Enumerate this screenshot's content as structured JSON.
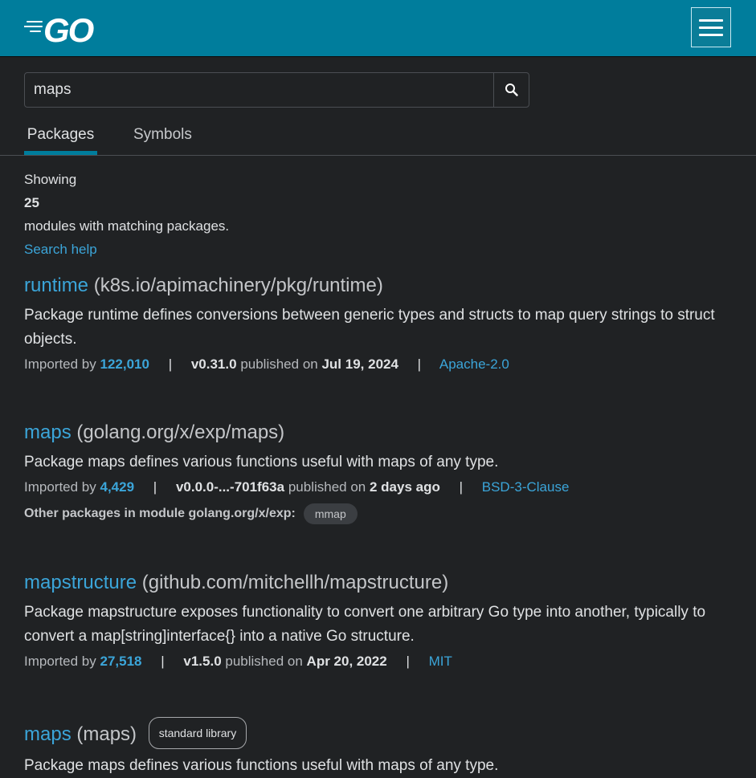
{
  "header": {
    "logo_text": "GO",
    "menu_icon": "hamburger-menu-icon"
  },
  "search": {
    "value": "maps",
    "icon": "search-icon"
  },
  "tabs": [
    {
      "label": "Packages",
      "active": true
    },
    {
      "label": "Symbols",
      "active": false
    }
  ],
  "summary": {
    "showing": "Showing",
    "count": "25",
    "text": "modules with matching packages.",
    "help_link": "Search help"
  },
  "results": [
    {
      "name": "runtime",
      "path": "(k8s.io/apimachinery/pkg/runtime)",
      "description": "Package runtime defines conversions between generic types and structs to map query strings to struct objects.",
      "imported_label": "Imported by",
      "imported_count": "122,010",
      "version": "v0.31.0",
      "published_label": "published on",
      "published": "Jul 19, 2024",
      "license": "Apache-2.0"
    },
    {
      "name": "maps",
      "path": "(golang.org/x/exp/maps)",
      "description": "Package maps defines various functions useful with maps of any type.",
      "imported_label": "Imported by",
      "imported_count": "4,429",
      "version": "v0.0.0-...-701f63a",
      "published_label": "published on",
      "published": "2 days ago",
      "license": "BSD-3-Clause",
      "other_label": "Other packages in module golang.org/x/exp:",
      "other_packages": [
        "mmap"
      ]
    },
    {
      "name": "mapstructure",
      "path": "(github.com/mitchellh/mapstructure)",
      "description": "Package mapstructure exposes functionality to convert one arbitrary Go type into another, typically to convert a map[string]interface{} into a native Go structure.",
      "imported_label": "Imported by",
      "imported_count": "27,518",
      "version": "v1.5.0",
      "published_label": "published on",
      "published": "Apr 20, 2022",
      "license": "MIT"
    },
    {
      "name": "maps",
      "path": "(maps)",
      "badge": "standard library",
      "description": "Package maps defines various functions useful with maps of any type."
    }
  ],
  "colors": {
    "header_bg": "#007d9c",
    "page_bg": "#202224",
    "link": "#3ba5d9"
  }
}
